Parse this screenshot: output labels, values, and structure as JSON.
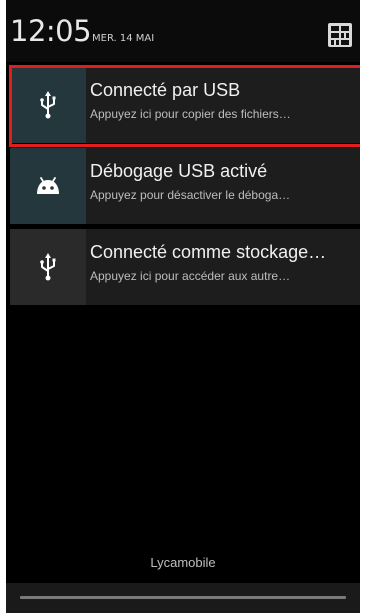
{
  "status": {
    "time": "12:05",
    "date": "MER. 14 MAI"
  },
  "header": {
    "quick_settings_icon": "quick-settings-grid-icon"
  },
  "notifications": [
    {
      "icon": "usb-icon",
      "title": "Connecté par USB",
      "subtitle": "Appuyez ici pour copier des fichiers…",
      "highlighted": true
    },
    {
      "icon": "android-debug-icon",
      "title": "Débogage USB activé",
      "subtitle": "Appuyez pour désactiver le déboga…"
    },
    {
      "icon": "usb-icon",
      "title": "Connecté comme stockage…",
      "subtitle": "Appuyez ici pour accéder aux autre…"
    }
  ],
  "footer": {
    "carrier": "Lycamobile"
  },
  "colors": {
    "highlight_border": "#e31d1d",
    "icon_box_active": "#23373d",
    "background": "#000000"
  }
}
